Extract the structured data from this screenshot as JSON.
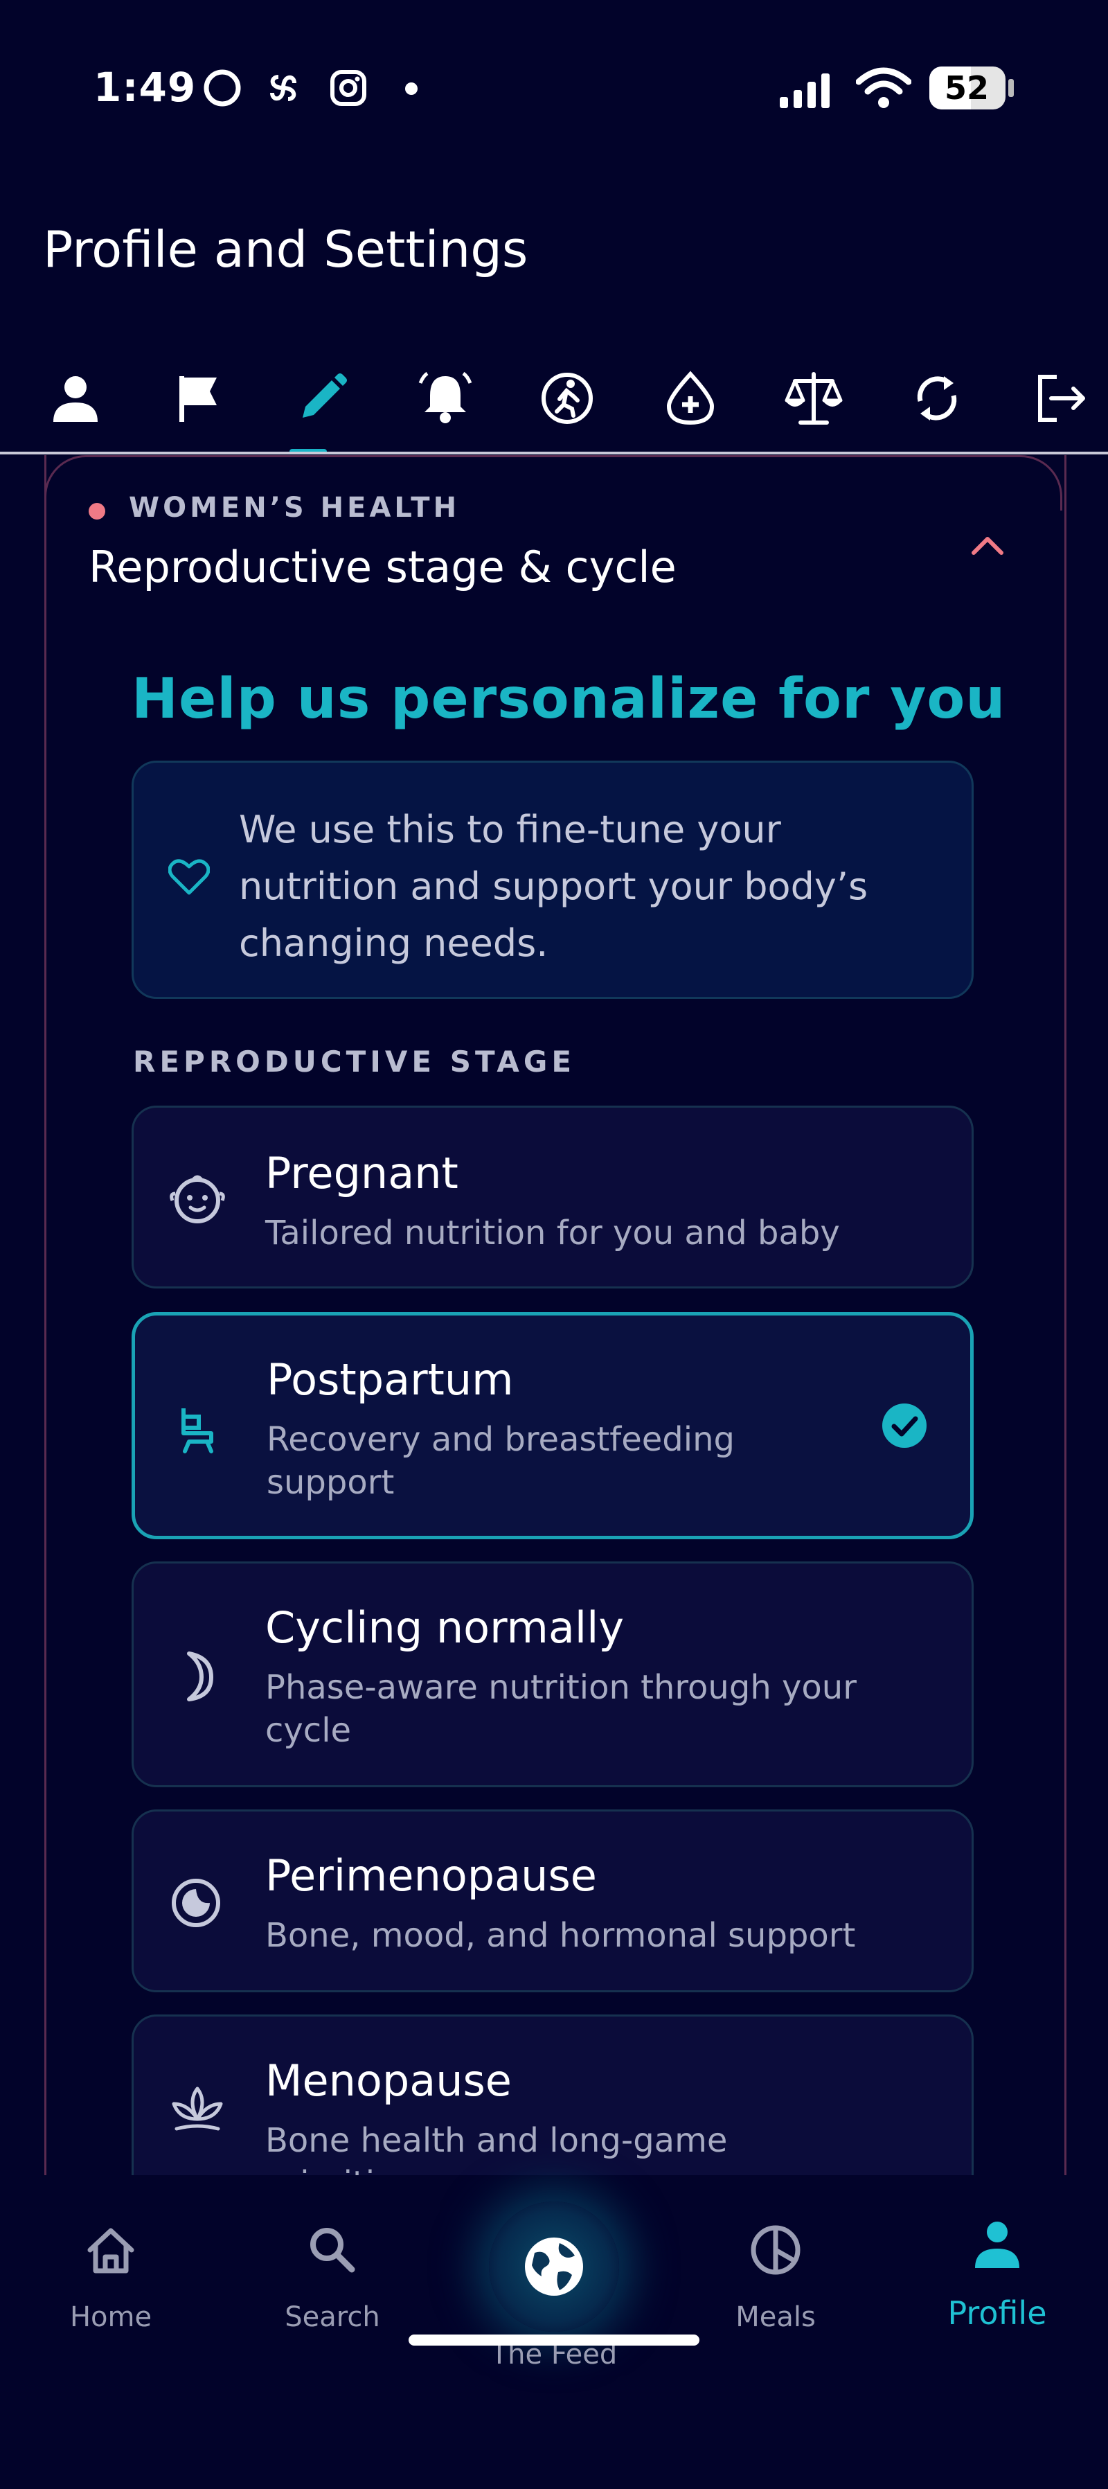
{
  "status_bar": {
    "time": "1:49",
    "battery": "52"
  },
  "header": {
    "title": "Profile and Settings"
  },
  "tabs": [
    {
      "icon": "person-icon"
    },
    {
      "icon": "flag-icon"
    },
    {
      "icon": "pencil-icon",
      "active": true
    },
    {
      "icon": "bell-icon"
    },
    {
      "icon": "activity-icon"
    },
    {
      "icon": "health-drop-icon"
    },
    {
      "icon": "scale-icon"
    },
    {
      "icon": "sync-icon"
    },
    {
      "icon": "logout-icon"
    }
  ],
  "card": {
    "eyebrow": "WOMEN’S HEALTH",
    "title": "Reproductive stage & cycle",
    "hero": "Help us personalize for you",
    "info": "We use this to fine-tune your nutrition and support your body’s changing needs.",
    "section_label": "REPRODUCTIVE STAGE",
    "options": [
      {
        "title": "Pregnant",
        "subtitle": "Tailored nutrition for you and baby",
        "icon": "baby-face-icon",
        "selected": false
      },
      {
        "title": "Postpartum",
        "subtitle": "Recovery and breastfeeding support",
        "icon": "chair-icon",
        "selected": true
      },
      {
        "title": "Cycling normally",
        "subtitle": "Phase-aware nutrition through your cycle",
        "icon": "moon-icon",
        "selected": false
      },
      {
        "title": "Perimenopause",
        "subtitle": "Bone, mood, and hormonal support",
        "icon": "moon-phase-icon",
        "selected": false
      },
      {
        "title": "Menopause",
        "subtitle": "Bone health and long-game priorities",
        "icon": "lotus-icon",
        "selected": false
      }
    ]
  },
  "bottom_nav": [
    {
      "label": "Home",
      "icon": "home-icon"
    },
    {
      "label": "Search",
      "icon": "search-icon"
    },
    {
      "label": "The Feed",
      "icon": "globe-icon"
    },
    {
      "label": "Meals",
      "icon": "pie-icon"
    },
    {
      "label": "Profile",
      "icon": "person-icon",
      "active": true
    }
  ],
  "colors": {
    "background": "#02032a",
    "accent": "#1ab5c5",
    "eyebrow_dot": "#f07a86"
  }
}
